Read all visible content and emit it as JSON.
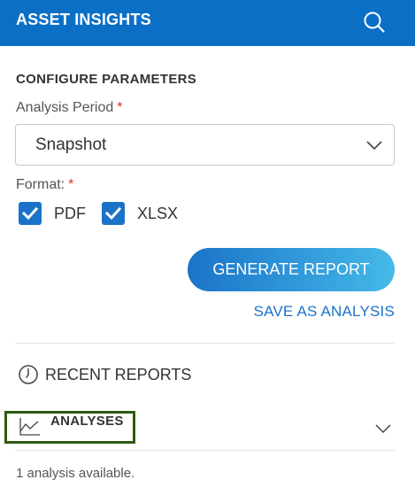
{
  "header": {
    "title": "ASSET INSIGHTS",
    "search_icon": "search-icon",
    "background_color": "#0b6fc6"
  },
  "configure": {
    "section_title": "CONFIGURE PARAMETERS",
    "analysis_period": {
      "label": "Analysis Period",
      "required_marker": "*",
      "selected_value": "Snapshot"
    },
    "format": {
      "label": "Format:",
      "required_marker": "*",
      "options": [
        {
          "label": "PDF",
          "checked": true
        },
        {
          "label": "XLSX",
          "checked": true
        }
      ]
    },
    "generate_button_label": "GENERATE REPORT",
    "save_link_label": "SAVE AS ANALYSIS"
  },
  "recent": {
    "label": "RECENT REPORTS",
    "icon": "clock-icon"
  },
  "analyses": {
    "label": "ANALYSES",
    "icon": "line-chart-icon",
    "highlight_color": "#2e5b0f",
    "count_text": "1 analysis available."
  },
  "colors": {
    "accent": "#1a73c8",
    "required": "#d9342b",
    "gradient_end": "#45b9e8"
  }
}
